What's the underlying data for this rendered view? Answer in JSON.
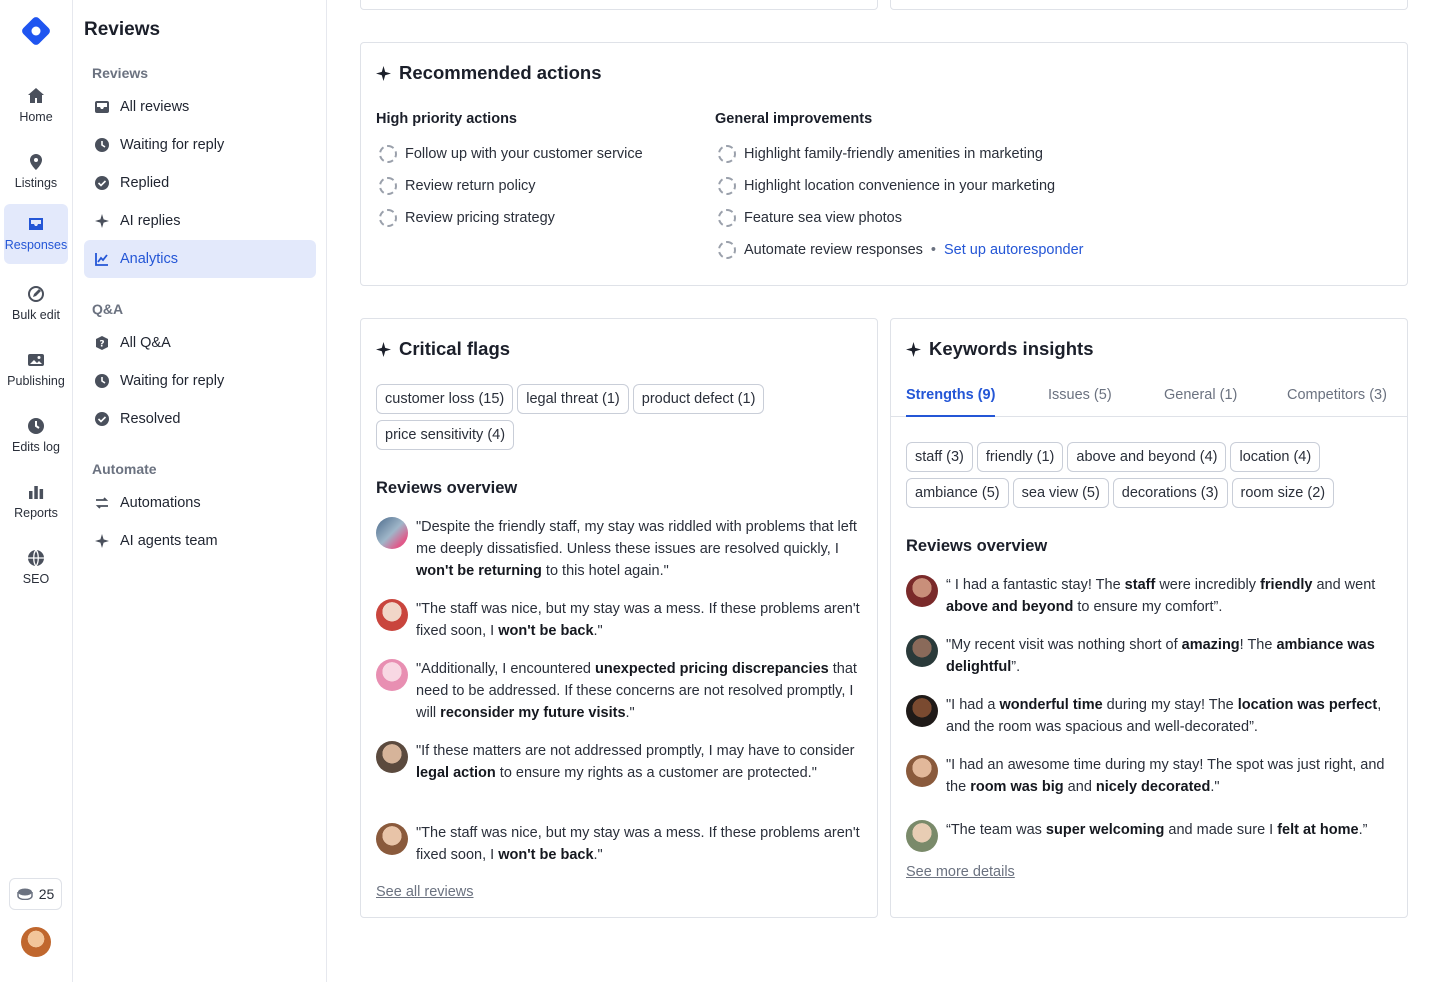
{
  "rail": {
    "items": [
      {
        "label": "Home",
        "icon": "home-icon"
      },
      {
        "label": "Listings",
        "icon": "pin-icon"
      },
      {
        "label": "Responses",
        "icon": "inbox-icon"
      },
      {
        "label": "Bulk edit",
        "icon": "bulk-edit-icon"
      },
      {
        "label": "Publishing",
        "icon": "image-icon"
      },
      {
        "label": "Edits log",
        "icon": "clock-icon"
      },
      {
        "label": "Reports",
        "icon": "bar-chart-icon"
      },
      {
        "label": "SEO",
        "icon": "globe-icon"
      }
    ],
    "credits": "25"
  },
  "subnav": {
    "title": "Reviews",
    "sections": [
      {
        "label": "Reviews",
        "items": [
          "All reviews",
          "Waiting for reply",
          "Replied",
          "AI replies",
          "Analytics"
        ]
      },
      {
        "label": "Q&A",
        "items": [
          "All Q&A",
          "Waiting for reply",
          "Resolved"
        ]
      },
      {
        "label": "Automate",
        "items": [
          "Automations",
          "AI agents team"
        ]
      }
    ]
  },
  "recommended": {
    "title": "Recommended actions",
    "high_title": "High priority actions",
    "high": [
      "Follow up with your customer service",
      "Review return policy",
      "Review pricing strategy"
    ],
    "general_title": "General improvements",
    "general": [
      "Highlight family-friendly amenities in marketing",
      "Highlight location convenience in your marketing",
      "Feature sea view photos",
      "Automate review responses"
    ],
    "separator": "•",
    "autoresponder_link": "Set up autoresponder"
  },
  "critical": {
    "title": "Critical flags",
    "chips": [
      "customer loss (15)",
      "legal threat (1)",
      "product defect (1)",
      "price sensitivity (4)"
    ],
    "overview_title": "Reviews overview",
    "see_all": "See all reviews"
  },
  "keywords": {
    "title": "Keywords insights",
    "tabs": [
      "Strengths (9)",
      "Issues (5)",
      "General (1)",
      "Competitors (3)"
    ],
    "chips": [
      "staff (3)",
      "friendly (1)",
      "above and beyond (4)",
      "location (4)",
      "ambiance (5)",
      "sea view (5)",
      "decorations (3)",
      "room size (2)"
    ],
    "overview_title": "Reviews overview",
    "see_more": "See more details"
  },
  "colors": {
    "accent": "#2456d6",
    "active_bg": "#e3e9fb",
    "border": "#dfe2e8"
  }
}
